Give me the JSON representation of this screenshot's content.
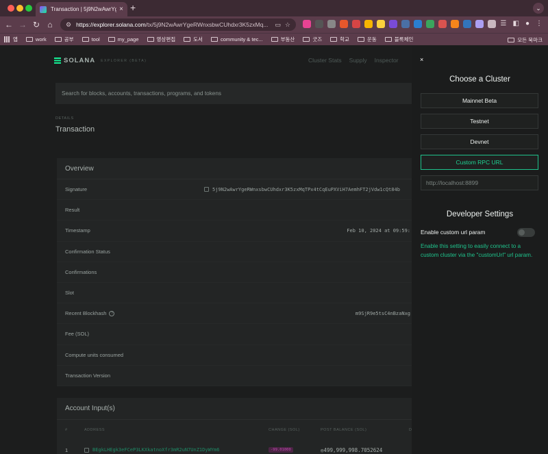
{
  "browser": {
    "tab_title": "Transaction | 5j9N2wAwrYgeR",
    "url_host": "https://explorer.solana.com",
    "url_path": "/tx/5j9N2wAwrYgeRWnxsbwCUhdxr3K5zxMq...",
    "bookmarks": [
      "앱",
      "work",
      "공부",
      "tool",
      "my_page",
      "영상편집",
      "도서",
      "community & tec...",
      "부동산",
      "굿즈",
      "학교",
      "운동",
      "블록체인"
    ],
    "bookmarks_right": "모든 북마크"
  },
  "header": {
    "logo": "SOLANA",
    "logo_sub": "EXPLORER (BETA)",
    "nav": [
      "Cluster Stats",
      "Supply",
      "Inspector"
    ]
  },
  "search": {
    "placeholder": "Search for blocks, accounts, transactions, programs, and tokens"
  },
  "page": {
    "label": "DETAILS",
    "title": "Transaction"
  },
  "overview": {
    "title": "Overview",
    "rows": [
      {
        "label": "Signature",
        "value": "5j9N2wAwrYgeRWnxsbwCUhdxr3K5zxMqTPx4tCqEuPXViH7AemhFT2jVdw1cQt84b"
      },
      {
        "label": "Result",
        "value": ""
      },
      {
        "label": "Timestamp",
        "value": "Feb 10, 2024 at 09:59:"
      },
      {
        "label": "Confirmation Status",
        "value": ""
      },
      {
        "label": "Confirmations",
        "value": ""
      },
      {
        "label": "Slot",
        "value": ""
      },
      {
        "label": "Recent Blockhash",
        "value": "m9SjR9e5tsC4nBzaNxg"
      },
      {
        "label": "Fee (SOL)",
        "value": ""
      },
      {
        "label": "Compute units consumed",
        "value": ""
      },
      {
        "label": "Transaction Version",
        "value": ""
      }
    ]
  },
  "accounts": {
    "title": "Account Input(s)",
    "columns": [
      "#",
      "ADDRESS",
      "CHANGE (SOL)",
      "POST BALANCE (SOL)",
      "D"
    ],
    "rows": [
      {
        "index": "1",
        "address": "BEgkLHEgk3eFCeP3LKXkatnoXfr3mR2uN7UnZ1DyWYm6",
        "change": "-99.01000",
        "post_balance": "◎499,999,998.7052624"
      }
    ]
  },
  "cluster_panel": {
    "close": "×",
    "title": "Choose a Cluster",
    "clusters": [
      "Mainnet Beta",
      "Testnet",
      "Devnet",
      "Custom RPC URL"
    ],
    "rpc_value": "http://localhost:8899",
    "dev_title": "Developer Settings",
    "toggle_label": "Enable custom url param",
    "toggle_description": "Enable this setting to easily connect to a custom cluster via the \"customUrl\" url param."
  },
  "colors": {
    "accent": "#1fd293",
    "tab_bar": "#3c2a33",
    "toolbar": "#5b3c4b"
  }
}
